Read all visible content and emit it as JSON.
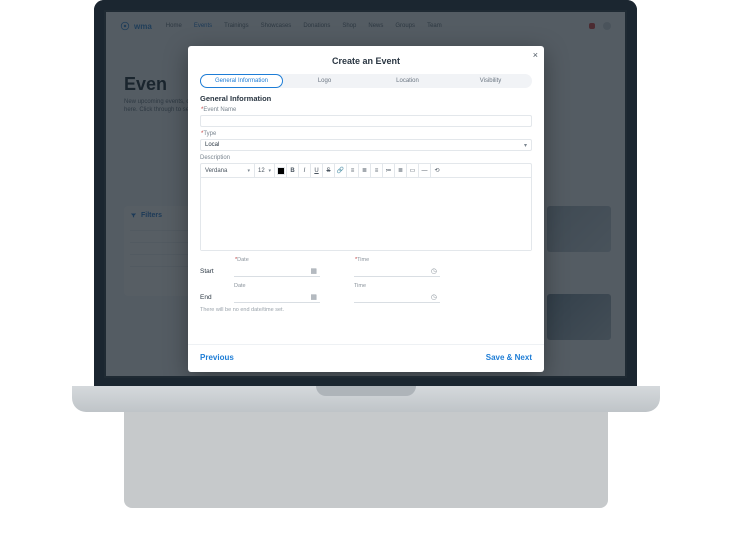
{
  "brand": {
    "name": "wma"
  },
  "nav": {
    "items": [
      "Home",
      "Events",
      "Trainings",
      "Showcases",
      "Donations",
      "Shop",
      "News",
      "Groups",
      "Team"
    ],
    "active_index": 1
  },
  "page": {
    "hero_title": "Even",
    "hero_sub": "New upcoming events, or past listed here. Click through to see details.",
    "filters_title": "Filters"
  },
  "modal": {
    "title": "Create an Event",
    "close_label": "×",
    "tabs": [
      "General Information",
      "Logo",
      "Location",
      "Visibility"
    ],
    "active_tab": 0,
    "section_heading": "General Information",
    "fields": {
      "event_name": {
        "label": "Event Name",
        "value": ""
      },
      "type": {
        "label": "Type",
        "value": "Local"
      },
      "description": {
        "label": "Description"
      }
    },
    "rte": {
      "font_family": "Verdana",
      "font_size": "12",
      "bold": "B",
      "italic": "I",
      "underline": "U",
      "strike": "S",
      "link": "🔗",
      "align_left": "≡",
      "align_center": "≣",
      "align_right": "≡",
      "list_ol": "≔",
      "list_ul": "≣",
      "image": "▭",
      "hr": "—",
      "clear": "⟲"
    },
    "dates": {
      "start_label": "Start",
      "end_label": "End",
      "date_sub": "Date",
      "time_sub": "Time",
      "start_date": "",
      "start_time": "",
      "end_date": "",
      "end_time": "",
      "tz_hint": "There will be no end date/time set."
    },
    "footer": {
      "prev": "Previous",
      "next": "Save & Next"
    }
  }
}
